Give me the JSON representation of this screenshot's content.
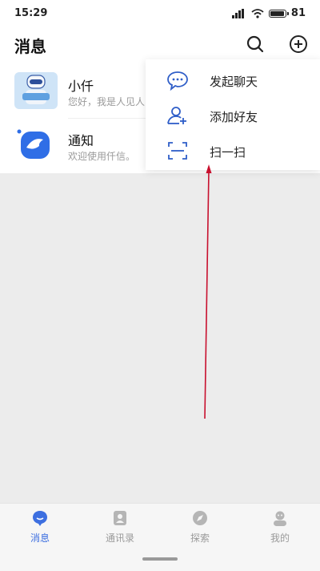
{
  "status_bar": {
    "time": "15:29",
    "battery": "81"
  },
  "header": {
    "title": "消息",
    "search_icon": "search-icon",
    "add_icon": "plus-circle-icon"
  },
  "conversations": [
    {
      "name": "小仟",
      "preview": "您好，我是人见人",
      "avatar": "robot-avatar"
    },
    {
      "name": "通知",
      "preview": "欢迎使用仟信。",
      "avatar": "bird-avatar"
    }
  ],
  "menu": {
    "items": [
      {
        "label": "发起聊天",
        "icon": "chat-bubble-icon"
      },
      {
        "label": "添加好友",
        "icon": "add-user-icon"
      },
      {
        "label": "扫一扫",
        "icon": "scan-icon"
      }
    ]
  },
  "tabbar": {
    "tabs": [
      {
        "label": "消息",
        "icon": "chat-icon",
        "active": true
      },
      {
        "label": "通讯录",
        "icon": "contacts-icon",
        "active": false
      },
      {
        "label": "探索",
        "icon": "compass-icon",
        "active": false
      },
      {
        "label": "我的",
        "icon": "profile-icon",
        "active": false
      }
    ]
  },
  "colors": {
    "accent": "#3d6fe0",
    "annotation_arrow": "#c8102e"
  }
}
